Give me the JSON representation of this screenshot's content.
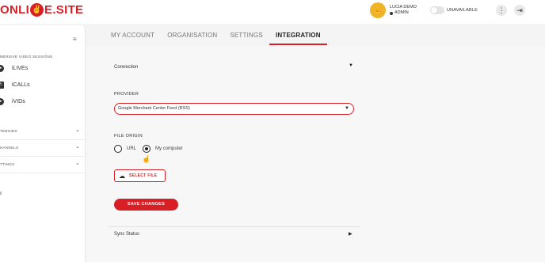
{
  "brand": {
    "logo_left": "ONLI",
    "logo_mark": "✌",
    "logo_right": "E.SITE"
  },
  "user": {
    "name": "LUCIA DEMO",
    "role": "ADMIN",
    "avatar_glyph": "✌"
  },
  "availability": {
    "label": "UNAVAILABLE",
    "enabled": false
  },
  "header_icons": {
    "menu": "⋮",
    "logout": "⇥"
  },
  "sidebar": {
    "collapse_glyph": "≡",
    "section_title": "MERSIVE VIDEO SESSIONS",
    "items": [
      {
        "label": "iLIVEs",
        "icon": "play-icon",
        "glyph": "▶"
      },
      {
        "label": "iCALLs",
        "icon": "phone-icon",
        "glyph": "✆"
      },
      {
        "label": "iVIDs",
        "icon": "video-icon",
        "glyph": "▶"
      }
    ],
    "groups": [
      {
        "label": "TEBOIDS"
      },
      {
        "label": "HANNELS"
      },
      {
        "label": "TTINGS"
      }
    ],
    "chevron": "⌄"
  },
  "tabs": [
    {
      "label": "MY ACCOUNT",
      "active": false
    },
    {
      "label": "ORGANISATION",
      "active": false
    },
    {
      "label": "SETTINGS",
      "active": false
    },
    {
      "label": "INTEGRATION",
      "active": true
    }
  ],
  "form": {
    "connection_label": "Connection",
    "collapse_arrow": "▼",
    "expand_arrow": "▶",
    "provider": {
      "label": "PROVIDER",
      "value": "Google Merchant Center Feed (RSS)"
    },
    "file_origin": {
      "label": "FILE ORIGIN",
      "options": [
        {
          "label": "URL",
          "selected": false
        },
        {
          "label": "My computer",
          "selected": true
        }
      ]
    },
    "select_file_label": "SELECT FILE",
    "save_label": "SAVE CHANGES",
    "sync_status_label": "Sync Status"
  },
  "colors": {
    "accent": "#d81f26",
    "avatar_bg": "#f0b429"
  }
}
